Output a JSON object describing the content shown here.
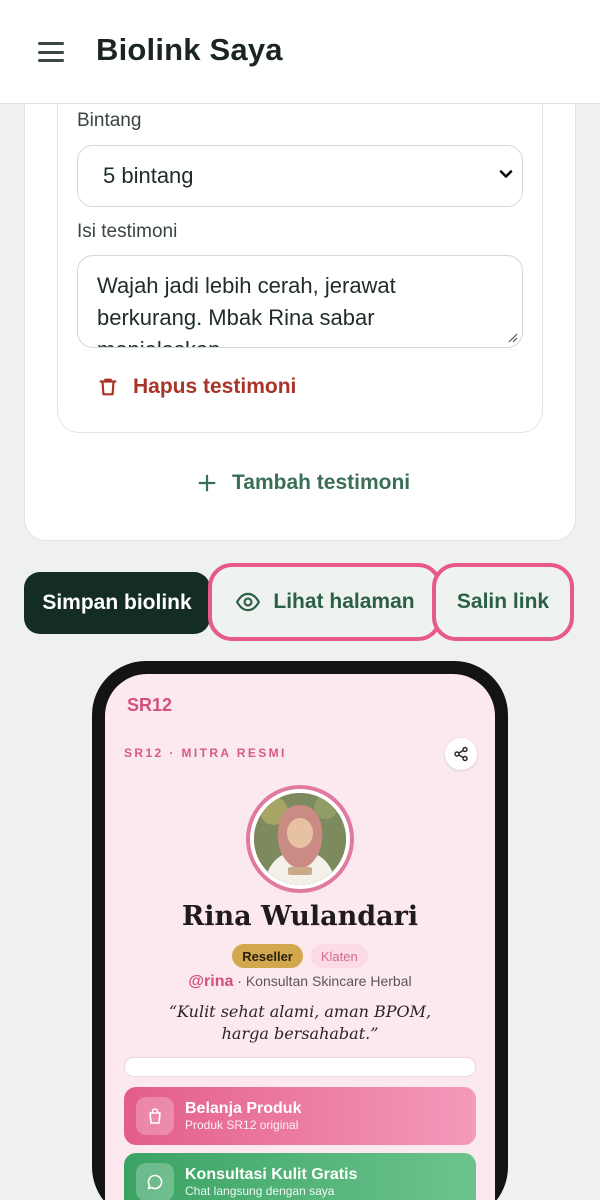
{
  "header": {
    "title": "Biolink Saya"
  },
  "editor": {
    "stars_label": "Bintang",
    "stars_value": "5 bintang",
    "content_label": "Isi testimoni",
    "content_value": "Wajah jadi lebih cerah, jerawat berkurang. Mbak Rina sabar menjelaskan.",
    "delete_label": "Hapus testimoni",
    "add_label": "Tambah testimoni"
  },
  "actions": {
    "save_label": "Simpan biolink",
    "view_label": "Lihat halaman",
    "copy_label": "Salin link",
    "highlight_color": "#e8588b"
  },
  "preview": {
    "brand": "SR12",
    "eyebrow": "SR12 · MITRA RESMI",
    "name": "Rina Wulandari",
    "role_badge": "Reseller",
    "location_badge": "Klaten",
    "handle": "@rina",
    "tagline": " · Konsultan Skincare Herbal",
    "quote": "“Kulit sehat alami, aman BPOM, harga bersahabat.”",
    "links": [
      {
        "title": "Belanja Produk",
        "subtitle": "Produk SR12 original",
        "icon": "bag-icon",
        "color": "#e35d8c"
      },
      {
        "title": "Konsultasi Kulit Gratis",
        "subtitle": "Chat langsung dengan saya",
        "icon": "chat-icon",
        "color": "#3aa364"
      }
    ]
  }
}
